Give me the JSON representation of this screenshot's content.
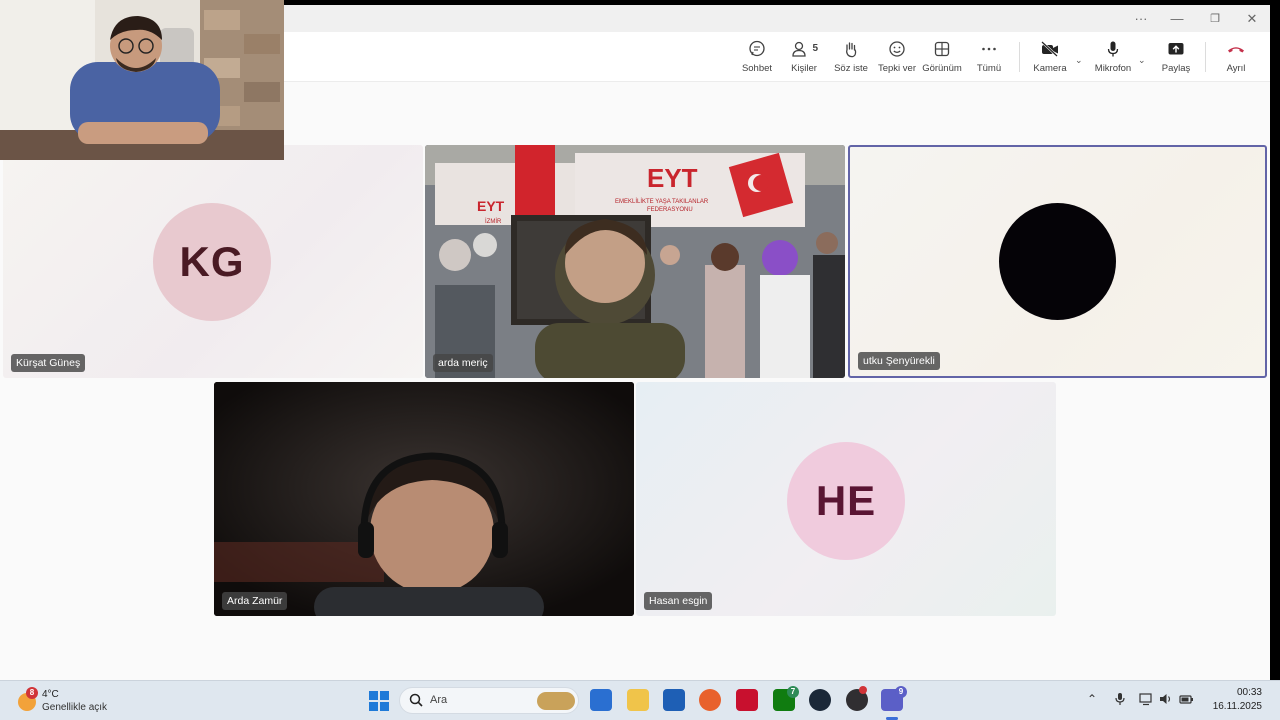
{
  "window": {
    "more_glyph": "···",
    "minimize_glyph": "—",
    "restore_glyph": "❐",
    "close_glyph": "✕"
  },
  "toolbar": {
    "chat": "Sohbet",
    "people": "Kişiler",
    "people_count": "5",
    "raise_hand": "Söz iste",
    "react": "Tepki ver",
    "view": "Görünüm",
    "more": "Tümü",
    "camera": "Kamera",
    "microphone": "Mikrofon",
    "share": "Paylaş",
    "leave": "Ayrıl"
  },
  "participants": [
    {
      "name": "Kürşat Güneş",
      "initials": "KG"
    },
    {
      "name": "arda meriç"
    },
    {
      "name": "utku Şenyürekli"
    },
    {
      "name": "Arda Zamür"
    },
    {
      "name": "Hasan esgin",
      "initials": "HE"
    }
  ],
  "banner": {
    "eyt": "EYT",
    "line1": "EMEKLİLİKTE YAŞA TAKILANLAR",
    "line2": "FEDERASYONU",
    "city": "İZMİR"
  },
  "taskbar": {
    "weather_temp": "4°C",
    "weather_desc": "Genellikle açık",
    "weather_badge": "8",
    "search_placeholder": "Ara",
    "xbox_badge": "7",
    "teams_badge": "9",
    "time": "00:33",
    "date": "16.11.2025"
  },
  "colors": {
    "accent_border": "#6264a7",
    "leave_red": "#c4314b",
    "avatar_kg_bg": "#e8c9cf",
    "avatar_kg_fg": "#4a1a24",
    "avatar_he_bg": "#f0cbdd",
    "avatar_he_fg": "#5a1533"
  }
}
